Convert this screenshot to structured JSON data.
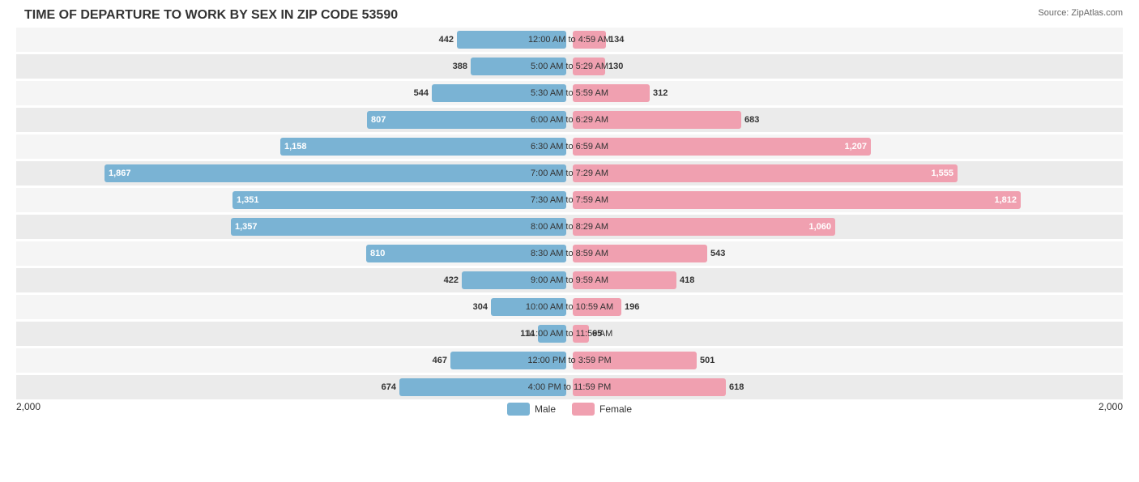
{
  "title": "TIME OF DEPARTURE TO WORK BY SEX IN ZIP CODE 53590",
  "source": "Source: ZipAtlas.com",
  "colors": {
    "male": "#7ab3d4",
    "female": "#f0a0b0"
  },
  "legend": {
    "male_label": "Male",
    "female_label": "Female"
  },
  "axis": {
    "left": "2,000",
    "right": "2,000"
  },
  "max_value": 1900,
  "chart_half_width": 580,
  "rows": [
    {
      "time": "12:00 AM to 4:59 AM",
      "male": 442,
      "female": 134
    },
    {
      "time": "5:00 AM to 5:29 AM",
      "male": 388,
      "female": 130
    },
    {
      "time": "5:30 AM to 5:59 AM",
      "male": 544,
      "female": 312
    },
    {
      "time": "6:00 AM to 6:29 AM",
      "male": 807,
      "female": 683
    },
    {
      "time": "6:30 AM to 6:59 AM",
      "male": 1158,
      "female": 1207
    },
    {
      "time": "7:00 AM to 7:29 AM",
      "male": 1867,
      "female": 1555
    },
    {
      "time": "7:30 AM to 7:59 AM",
      "male": 1351,
      "female": 1812
    },
    {
      "time": "8:00 AM to 8:29 AM",
      "male": 1357,
      "female": 1060
    },
    {
      "time": "8:30 AM to 8:59 AM",
      "male": 810,
      "female": 543
    },
    {
      "time": "9:00 AM to 9:59 AM",
      "male": 422,
      "female": 418
    },
    {
      "time": "10:00 AM to 10:59 AM",
      "male": 304,
      "female": 196
    },
    {
      "time": "11:00 AM to 11:59 AM",
      "male": 114,
      "female": 65
    },
    {
      "time": "12:00 PM to 3:59 PM",
      "male": 467,
      "female": 501
    },
    {
      "time": "4:00 PM to 11:59 PM",
      "male": 674,
      "female": 618
    }
  ]
}
